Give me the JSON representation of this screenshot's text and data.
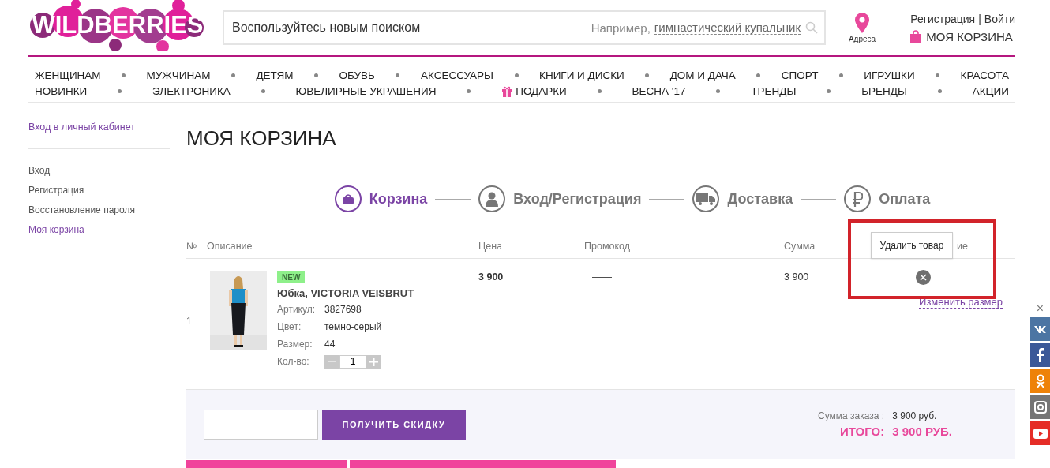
{
  "header": {
    "logo": "WILDBERRIES",
    "search": {
      "placeholder": "Воспользуйтесь новым поиском",
      "example_prefix": "Например,",
      "example": "гимнастический купальник"
    },
    "address_label": "Адреса",
    "register": "Регистрация",
    "separator": "|",
    "login": "Войти",
    "cart": "МОЯ КОРЗИНА"
  },
  "nav": [
    [
      {
        "label": "ЖЕНЩИНАМ",
        "has_icon": false
      },
      {
        "label": "МУЖЧИНАМ",
        "has_icon": false
      },
      {
        "label": "ДЕТЯМ",
        "has_icon": false
      },
      {
        "label": "ОБУВЬ",
        "has_icon": false
      },
      {
        "label": "АКСЕССУАРЫ",
        "has_icon": false
      },
      {
        "label": "КНИГИ И ДИСКИ",
        "has_icon": false
      },
      {
        "label": "ДОМ И ДАЧА",
        "has_icon": false
      },
      {
        "label": "СПОРТ",
        "has_icon": false
      },
      {
        "label": "ИГРУШКИ",
        "has_icon": false
      },
      {
        "label": "КРАСОТА",
        "has_icon": false
      }
    ],
    [
      {
        "label": "НОВИНКИ",
        "has_icon": false
      },
      {
        "label": "ЭЛЕКТРОНИКА",
        "has_icon": false
      },
      {
        "label": "ЮВЕЛИРНЫЕ УКРАШЕНИЯ",
        "has_icon": false
      },
      {
        "label": "ПОДАРКИ",
        "has_icon": true
      },
      {
        "label": "ВЕСНА '17",
        "has_icon": false
      },
      {
        "label": "ТРЕНДЫ",
        "has_icon": false
      },
      {
        "label": "БРЕНДЫ",
        "has_icon": false
      },
      {
        "label": "АКЦИИ",
        "has_icon": false
      }
    ]
  ],
  "sidebar": {
    "title": "Вход в личный кабинет",
    "items": [
      {
        "label": "Вход",
        "selected": false
      },
      {
        "label": "Регистрация",
        "selected": false
      },
      {
        "label": "Восстановление пароля",
        "selected": false
      },
      {
        "label": "Моя корзина",
        "selected": true
      }
    ]
  },
  "page_title": "МОЯ КОРЗИНА",
  "steps": [
    {
      "label": "Корзина",
      "kind": "cart",
      "selected": true
    },
    {
      "label": "Вход/Регистрация",
      "kind": "user",
      "selected": false
    },
    {
      "label": "Доставка",
      "kind": "truck",
      "selected": false
    },
    {
      "label": "Оплата",
      "kind": "ruble",
      "selected": false
    }
  ],
  "table": {
    "columns": [
      "№",
      "Описание",
      "Цена",
      "Промокод",
      "Сумма",
      "ие"
    ],
    "rows": [
      {
        "number": "1",
        "badge": "NEW",
        "title": "Юбка, VICTORIA VEISBRUT",
        "details": [
          {
            "label": "Артикул:",
            "value": "3827698"
          },
          {
            "label": "Цвет:",
            "value": "темно-серый"
          },
          {
            "label": "Размер:",
            "value": "44"
          }
        ],
        "quantity_label": "Кол-во:",
        "quantity": "1",
        "price": "3 900",
        "promo": "——",
        "sum": "3 900",
        "change_size": "Изменить размер"
      }
    ]
  },
  "tooltip": "Удалить товар",
  "promo": {
    "button": "ПОЛУЧИТЬ СКИДКУ"
  },
  "totals": {
    "order_label": "Сумма заказа :",
    "order_value": "3 900 руб.",
    "total_label": "ИТОГО:",
    "total_value": "3 900 РУБ."
  },
  "social": {
    "close": "×",
    "items": [
      {
        "kind": "vk",
        "color": "#4c75a3"
      },
      {
        "kind": "facebook",
        "color": "#3b5998"
      },
      {
        "kind": "ok",
        "color": "#ee8208"
      },
      {
        "kind": "instagram",
        "color": "#757575"
      },
      {
        "kind": "youtube",
        "color": "#e52d27"
      }
    ]
  }
}
